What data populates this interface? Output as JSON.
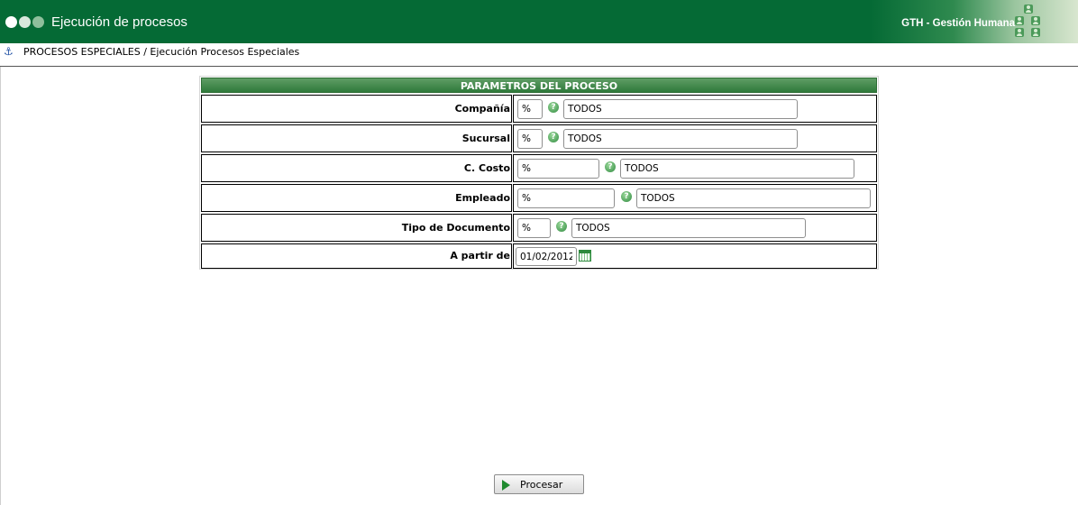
{
  "header": {
    "title": "Ejecución de procesos",
    "app_name": "GTH - Gestión Humana",
    "icons": [
      "logo-dots",
      "user-group-icon"
    ]
  },
  "breadcrumb": {
    "text": "PROCESOS ESPECIALES / Ejecución Procesos Especiales",
    "icon": "anchor-icon"
  },
  "params": {
    "title": "PARAMETROS DEL PROCESO",
    "rows": [
      {
        "label": "Compañía",
        "code": "%",
        "description": "TODOS"
      },
      {
        "label": "Sucursal",
        "code": "%",
        "description": "TODOS"
      },
      {
        "label": "C. Costo",
        "code": "%",
        "description": "TODOS"
      },
      {
        "label": "Empleado",
        "code": "%",
        "description": "TODOS"
      },
      {
        "label": "Tipo de Documento",
        "code": "%",
        "description": "TODOS"
      },
      {
        "label": "A partir de",
        "date": "01/02/2012"
      }
    ]
  },
  "actions": {
    "process_label": "Procesar"
  },
  "colors": {
    "header_bg": "#056a35",
    "title_bar": "#2f7a3b",
    "accent_green": "#1f8a2f"
  }
}
